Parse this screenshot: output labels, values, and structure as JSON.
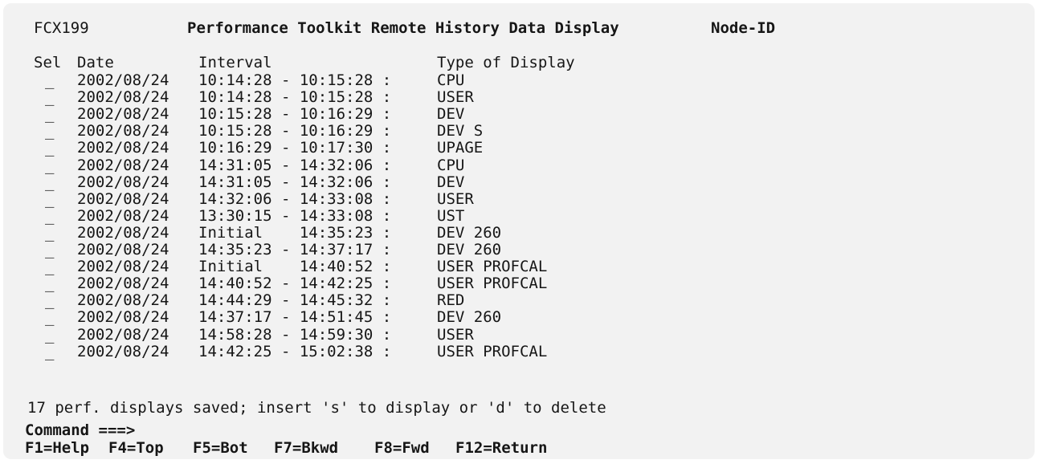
{
  "header": {
    "panel_id": "FCX199",
    "title": "Performance Toolkit Remote History Data Display",
    "node_label": "Node-ID"
  },
  "columns": {
    "sel": "Sel",
    "date": "Date",
    "interval": "Interval",
    "type": "Type of Display"
  },
  "rows": [
    {
      "sel": "_",
      "date": "2002/08/24",
      "interval": "10:14:28 - 10:15:28 :",
      "type": "CPU"
    },
    {
      "sel": "_",
      "date": "2002/08/24",
      "interval": "10:14:28 - 10:15:28 :",
      "type": "USER"
    },
    {
      "sel": "_",
      "date": "2002/08/24",
      "interval": "10:15:28 - 10:16:29 :",
      "type": "DEV"
    },
    {
      "sel": "_",
      "date": "2002/08/24",
      "interval": "10:15:28 - 10:16:29 :",
      "type": "DEV S"
    },
    {
      "sel": "_",
      "date": "2002/08/24",
      "interval": "10:16:29 - 10:17:30 :",
      "type": "UPAGE"
    },
    {
      "sel": "_",
      "date": "2002/08/24",
      "interval": "14:31:05 - 14:32:06 :",
      "type": "CPU"
    },
    {
      "sel": "_",
      "date": "2002/08/24",
      "interval": "14:31:05 - 14:32:06 :",
      "type": "DEV"
    },
    {
      "sel": "_",
      "date": "2002/08/24",
      "interval": "14:32:06 - 14:33:08 :",
      "type": "USER"
    },
    {
      "sel": "_",
      "date": "2002/08/24",
      "interval": "13:30:15 - 14:33:08 :",
      "type": "UST"
    },
    {
      "sel": "_",
      "date": "2002/08/24",
      "interval": "Initial    14:35:23 :",
      "type": "DEV 260"
    },
    {
      "sel": "_",
      "date": "2002/08/24",
      "interval": "14:35:23 - 14:37:17 :",
      "type": "DEV 260"
    },
    {
      "sel": "_",
      "date": "2002/08/24",
      "interval": "Initial    14:40:52 :",
      "type": "USER PROFCAL"
    },
    {
      "sel": "_",
      "date": "2002/08/24",
      "interval": "14:40:52 - 14:42:25 :",
      "type": "USER PROFCAL"
    },
    {
      "sel": "_",
      "date": "2002/08/24",
      "interval": "14:44:29 - 14:45:32 :",
      "type": "RED"
    },
    {
      "sel": "_",
      "date": "2002/08/24",
      "interval": "14:37:17 - 14:51:45 :",
      "type": "DEV 260"
    },
    {
      "sel": "_",
      "date": "2002/08/24",
      "interval": "14:58:28 - 14:59:30 :",
      "type": "USER"
    },
    {
      "sel": "_",
      "date": "2002/08/24",
      "interval": "14:42:25 - 15:02:38 :",
      "type": "USER PROFCAL"
    }
  ],
  "status_message": "17 perf. displays saved; insert 's' to display or 'd' to delete",
  "command": {
    "label": "Command ===>",
    "value": ""
  },
  "function_keys": {
    "f1": "F1=Help",
    "f4": "F4=Top",
    "f5": "F5=Bot",
    "f7": "F7=Bkwd",
    "f8": "F8=Fwd",
    "f12": "F12=Return"
  },
  "colors": {
    "background": "#f2f2f2",
    "text": "#161616"
  }
}
